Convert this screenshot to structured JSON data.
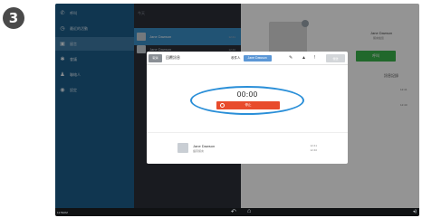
{
  "step": {
    "number": "3"
  },
  "nav": {
    "items": [
      {
        "icon": "phone-icon",
        "glyph": "✆",
        "label": "呼叫"
      },
      {
        "icon": "clock-icon",
        "glyph": "◷",
        "label": "最近的活動"
      },
      {
        "icon": "voicemail-icon",
        "glyph": "▣",
        "label": "留言"
      },
      {
        "icon": "meeting-icon",
        "glyph": "✱",
        "label": "會議"
      },
      {
        "icon": "contacts-icon",
        "glyph": "♟",
        "label": "聯絡人"
      },
      {
        "icon": "settings-icon",
        "glyph": "◉",
        "label": "設定"
      }
    ]
  },
  "list": {
    "header": "今天",
    "rows": [
      {
        "name": "Jane Dawson",
        "time": "12:41"
      },
      {
        "name": "Jane Dawson",
        "time": "12:40"
      }
    ]
  },
  "detail": {
    "name": "Jane Dawson",
    "sub": "留言給您",
    "call_label": "呼叫",
    "section_title": "訊息記錄",
    "notes": [
      "12:41",
      "12:40"
    ]
  },
  "modal": {
    "cancel_label": "取消",
    "title": "回覆訊息",
    "recipient_label": "收件人",
    "recipient_value": "Jane Dawson",
    "send_label": "傳送",
    "timer": "00:00",
    "stop_label": "停止",
    "recent": {
      "name": "Jane Dawson",
      "sub": "語音留言",
      "time1": "12:41",
      "time2": "12:40"
    }
  },
  "bottombar": {
    "left_text": "11:53AM",
    "back_glyph": "↶",
    "home_glyph": "⌂",
    "right_glyph": "◂)"
  },
  "colors": {
    "accent": "#3a8fc9",
    "record": "#e84b2c",
    "call": "#3ab34a",
    "highlight": "#2a8fd8"
  }
}
